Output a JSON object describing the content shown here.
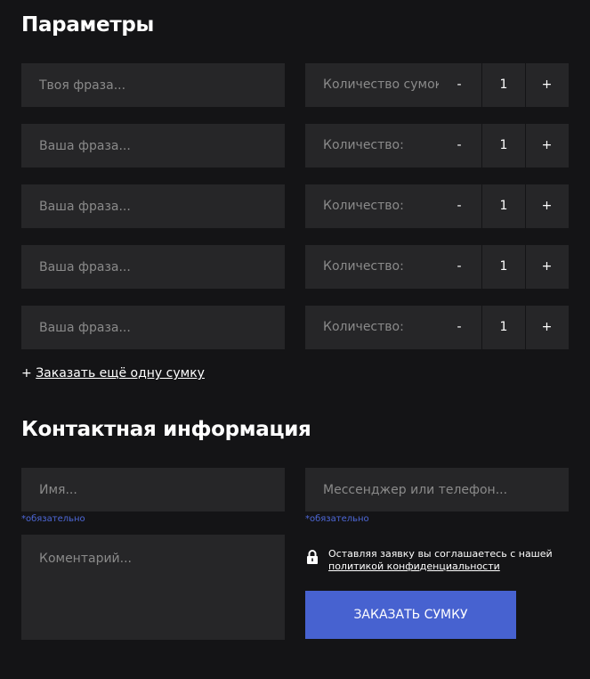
{
  "params_section": {
    "title": "Параметры",
    "rows": [
      {
        "phrase_placeholder": "Твоя фраза...",
        "qty_label": "Количество сумок:",
        "minus": "-",
        "value": "1",
        "plus": "+"
      },
      {
        "phrase_placeholder": "Ваша фраза...",
        "qty_label": "Количество:",
        "minus": "-",
        "value": "1",
        "plus": "+"
      },
      {
        "phrase_placeholder": "Ваша фраза...",
        "qty_label": "Количество:",
        "minus": "-",
        "value": "1",
        "plus": "+"
      },
      {
        "phrase_placeholder": "Ваша фраза...",
        "qty_label": "Количество:",
        "minus": "-",
        "value": "1",
        "plus": "+"
      },
      {
        "phrase_placeholder": "Ваша фраза...",
        "qty_label": "Количество:",
        "minus": "-",
        "value": "1",
        "plus": "+"
      }
    ],
    "add_more_prefix": "+",
    "add_more_link": "Заказать ещё одну сумку"
  },
  "contact_section": {
    "title": "Контактная информация",
    "name_placeholder": "Имя...",
    "contact_placeholder": "Мессенджер или телефон...",
    "required_note": "*обязательно",
    "comment_placeholder": "Коментарий...",
    "privacy_text": "Оставляя заявку вы соглашаетесь с нашей",
    "privacy_link": "политикой конфиденциальности",
    "submit_label": "Заказать сумку"
  },
  "colors": {
    "background": "#141416",
    "field_bg": "#262628",
    "accent": "#4762d0",
    "required_text": "#4e68d8"
  },
  "icons": {
    "lock": "lock-icon"
  }
}
